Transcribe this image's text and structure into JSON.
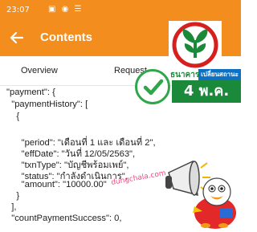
{
  "statusbar": {
    "time": "23:07",
    "icons": "▣ ◉ ☰"
  },
  "appbar": {
    "title": "Contents",
    "back_icon": "arrow-left-icon",
    "bg": "#f28d1e"
  },
  "tabs": [
    {
      "label": "Overview"
    },
    {
      "label": "Request"
    }
  ],
  "code_lines": [
    "\"payment\": {",
    "  \"paymentHistory\": [",
    "    {",
    "",
    "      \"period\": \"เดือนที่ 1 และ เดือนที่ 2\",",
    "      \"effDate\": \"วันที่ 12/05/2563\",",
    "      \"txnType\": \"บัญชีพร้อมเพย์\",",
    "      \"status\": \"กำลังดำเนินการ\",",
    "      \"amount\": \"10000.00\"",
    "    }",
    "  ],",
    "  \"countPaymentSuccess\": 0,"
  ],
  "overlay": {
    "logo_caption": "ธนาคารกสิ",
    "tag_label": "เปลี่ยนสถานะ",
    "date_label": "4 พ.ค.",
    "watermark": "dungchala.com",
    "accent_green": "#1a8a3a"
  }
}
